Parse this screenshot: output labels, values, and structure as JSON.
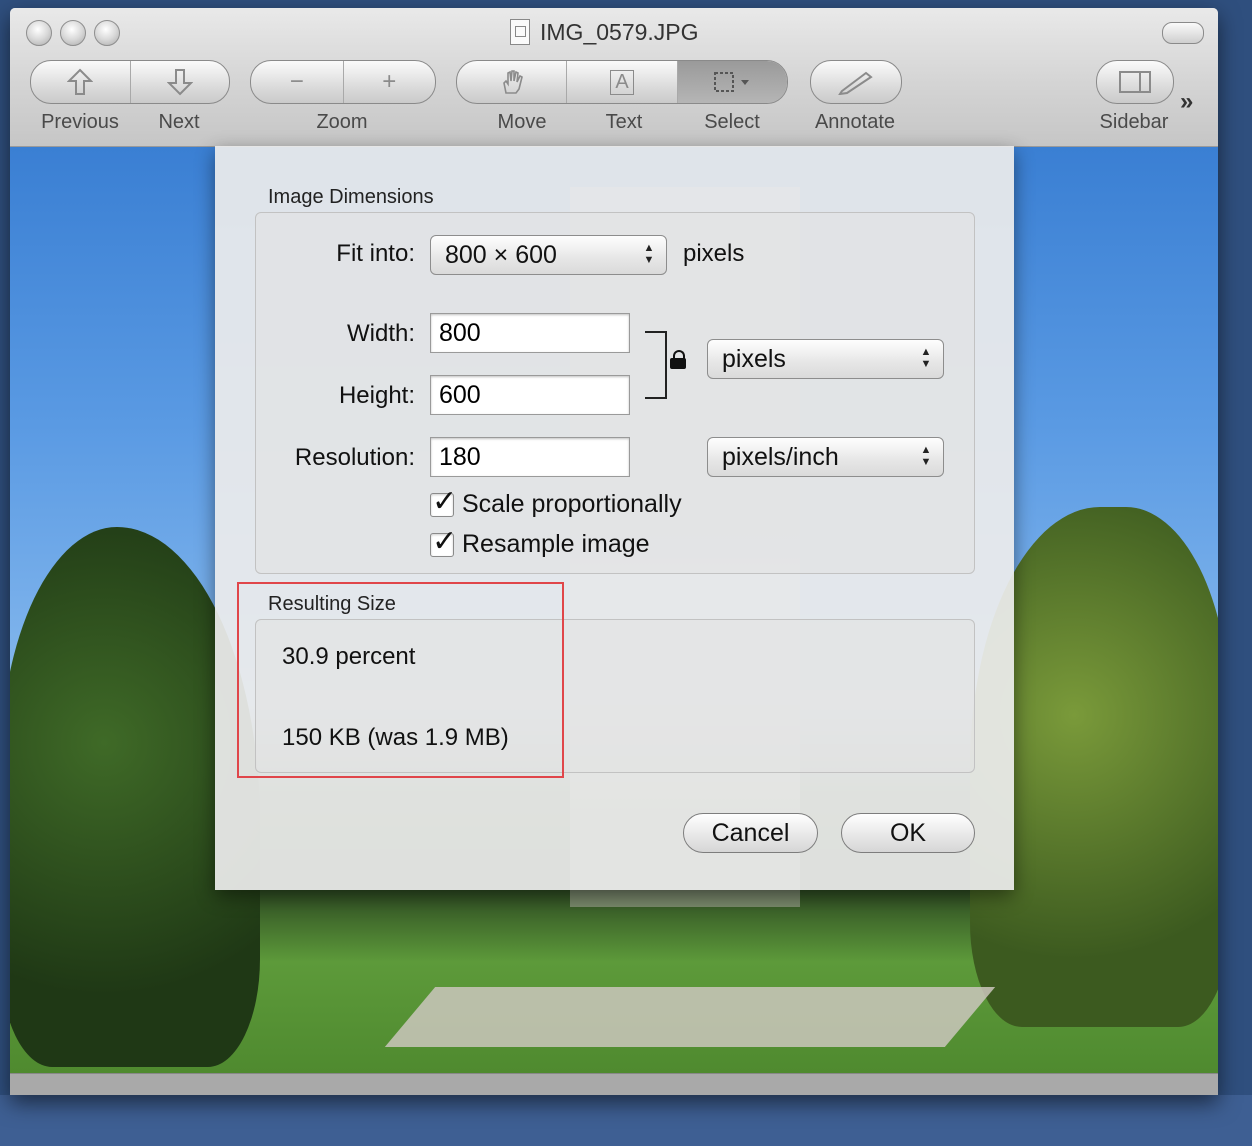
{
  "window": {
    "title": "IMG_0579.JPG"
  },
  "toolbar": {
    "previous_label": "Previous",
    "next_label": "Next",
    "zoom_label": "Zoom",
    "move_label": "Move",
    "text_label": "Text",
    "select_label": "Select",
    "annotate_label": "Annotate",
    "sidebar_label": "Sidebar",
    "overflow_glyph": "»",
    "zoom_out_glyph": "−",
    "zoom_in_glyph": "+",
    "text_tool_glyph": "A"
  },
  "dialog": {
    "dimensions_group_label": "Image Dimensions",
    "fit_into_label": "Fit into:",
    "fit_into_value": "800 × 600",
    "fit_into_unit": "pixels",
    "width_label": "Width:",
    "width_value": "800",
    "height_label": "Height:",
    "height_value": "600",
    "size_unit_value": "pixels",
    "resolution_label": "Resolution:",
    "resolution_value": "180",
    "resolution_unit_value": "pixels/inch",
    "scale_proportionally_label": "Scale proportionally",
    "scale_proportionally_checked": true,
    "resample_label": "Resample image",
    "resample_checked": true,
    "result_group_label": "Resulting Size",
    "result_percent": "30.9 percent",
    "result_filesize": "150 KB (was 1.9 MB)",
    "cancel_label": "Cancel",
    "ok_label": "OK"
  },
  "annotation_color": "#e0464a"
}
